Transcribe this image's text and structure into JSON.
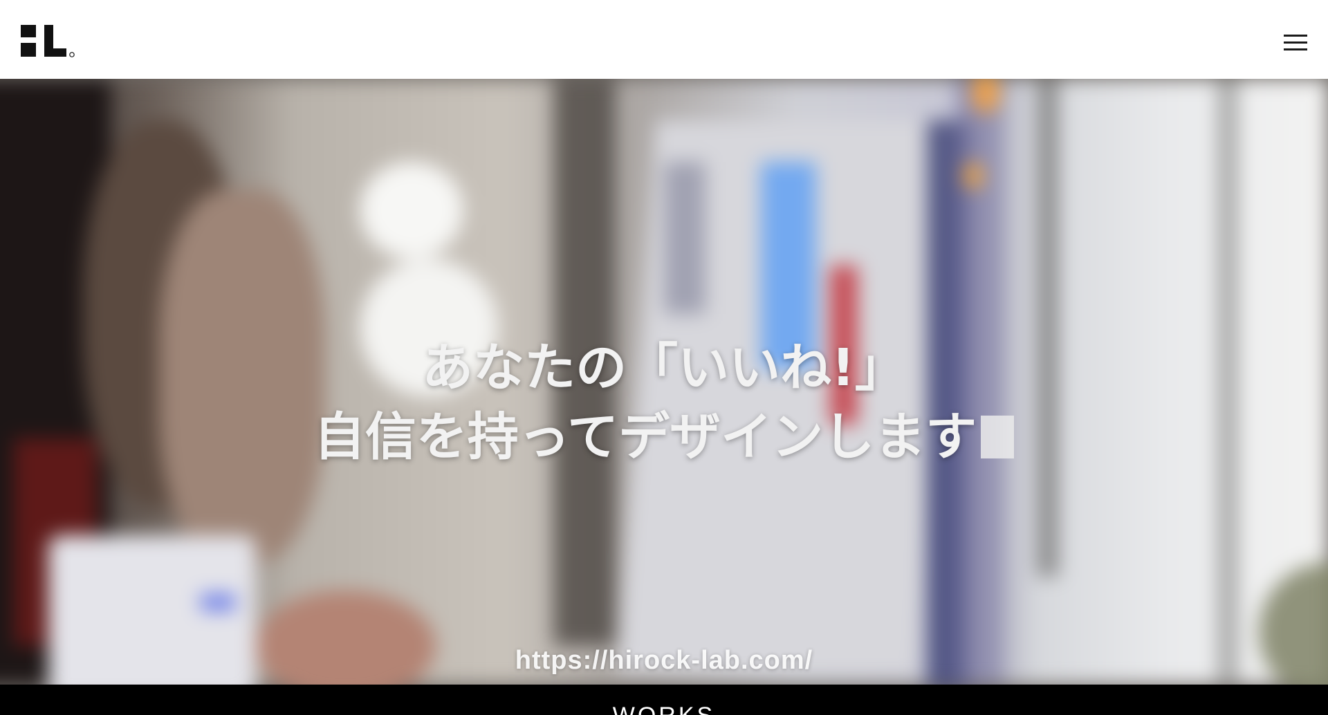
{
  "header": {
    "logo_icon": "hl-logo-icon",
    "menu_icon": "hamburger-menu-icon"
  },
  "hero": {
    "line1": "あなたの「いいね!」",
    "line2": "自信を持ってデザインします",
    "url": "https://hirock-lab.com/"
  },
  "works": {
    "label": "WORKS"
  },
  "colors": {
    "header_bg": "#ffffff",
    "logo": "#111111",
    "hero_text": "#f2f2f2",
    "works_bg": "#000000"
  }
}
